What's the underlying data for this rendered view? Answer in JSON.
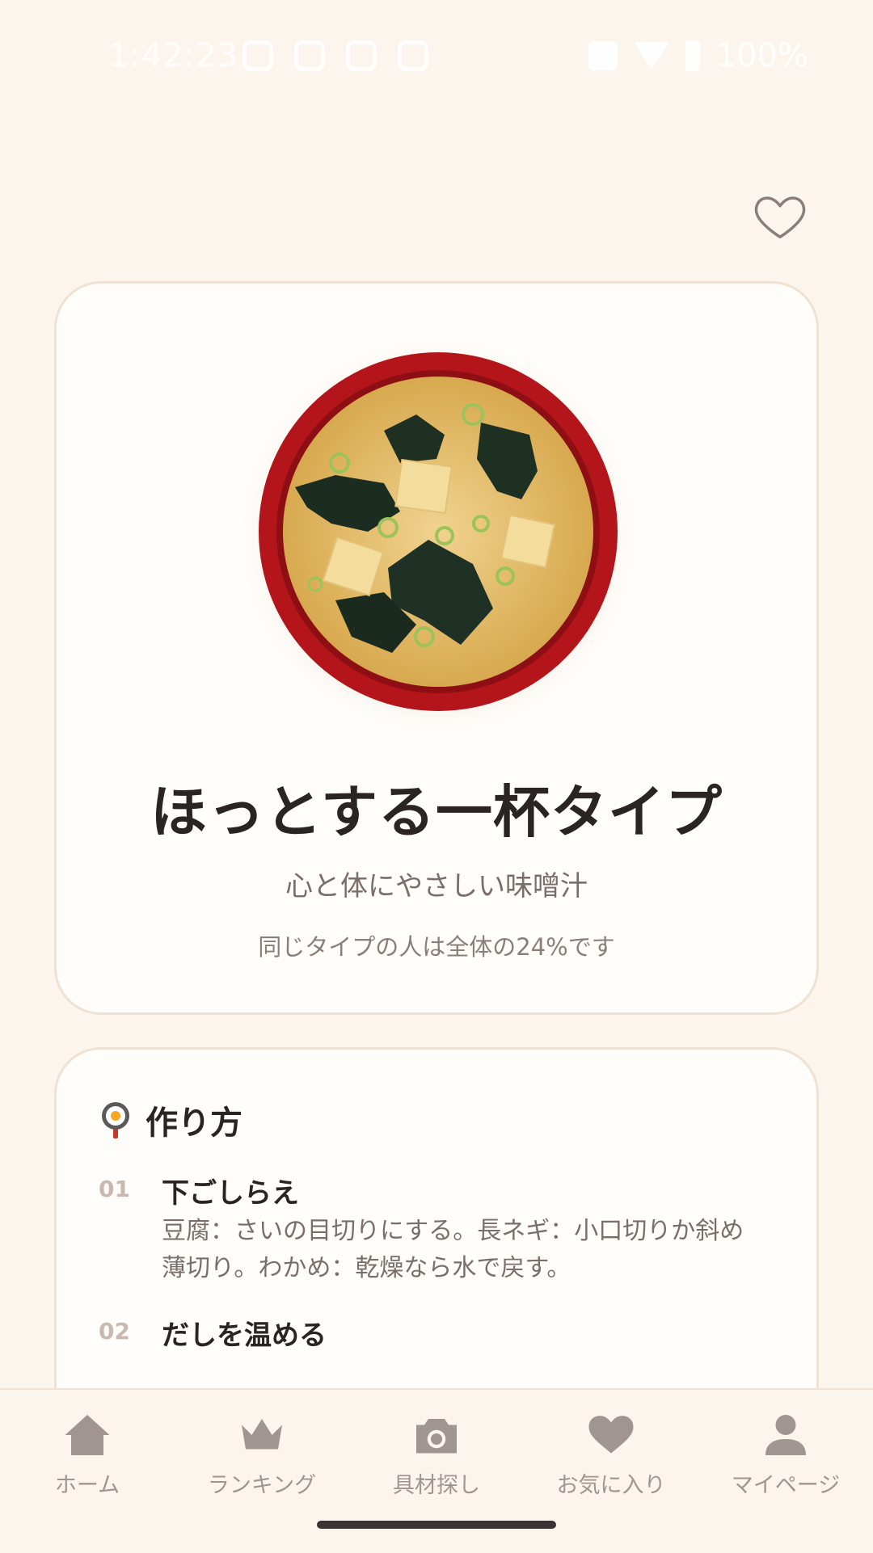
{
  "status_bar": {
    "time": "1:42:23",
    "battery": "100%"
  },
  "result": {
    "title": "ほっとする一杯タイプ",
    "subtitle": "心と体にやさしい味噌汁",
    "ratio_text": "同じタイプの人は全体の24%です"
  },
  "recipe": {
    "heading_icon": "🍳",
    "heading": "作り方",
    "steps": [
      {
        "num": "01",
        "title": "下ごしらえ",
        "body": "豆腐：さいの目切りにする。長ネギ：小口切りか斜め薄切り。わかめ：乾燥なら水で戻す。"
      },
      {
        "num": "02",
        "title": "だしを温める",
        "body": ""
      }
    ]
  },
  "nav": {
    "items": [
      {
        "label": "ホーム",
        "icon": "home-icon"
      },
      {
        "label": "ランキング",
        "icon": "crown-icon"
      },
      {
        "label": "具材探し",
        "icon": "camera-icon"
      },
      {
        "label": "お気に入り",
        "icon": "heart-icon"
      },
      {
        "label": "マイページ",
        "icon": "person-icon"
      }
    ]
  },
  "colors": {
    "background": "#fcf5ed",
    "card": "#fffdf9",
    "nav_icon": "#a09590",
    "bowl": "#b3151a",
    "soup": "#e0b867"
  }
}
